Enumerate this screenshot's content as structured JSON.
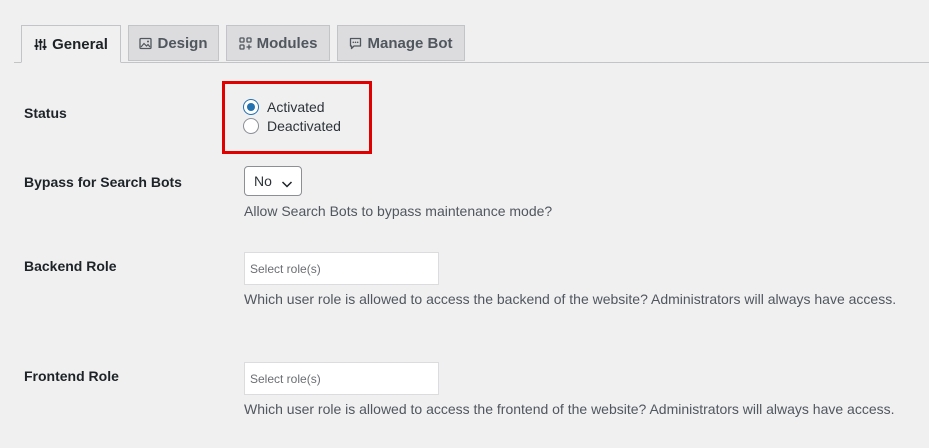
{
  "tabs": [
    {
      "label": "General",
      "icon": "sliders-icon",
      "active": true
    },
    {
      "label": "Design",
      "icon": "image-icon",
      "active": false
    },
    {
      "label": "Modules",
      "icon": "modules-icon",
      "active": false
    },
    {
      "label": "Manage Bot",
      "icon": "chat-bubble-icon",
      "active": false
    }
  ],
  "status": {
    "label": "Status",
    "options": [
      "Activated",
      "Deactivated"
    ],
    "selected": "Activated"
  },
  "bypass": {
    "label": "Bypass for Search Bots",
    "value": "No",
    "description": "Allow Search Bots to bypass maintenance mode?"
  },
  "backend_role": {
    "label": "Backend Role",
    "placeholder": "Select role(s)",
    "description": "Which user role is allowed to access the backend of the website? Administrators will always have access."
  },
  "frontend_role": {
    "label": "Frontend Role",
    "placeholder": "Select role(s)",
    "description": "Which user role is allowed to access the frontend of the website? Administrators will always have access."
  },
  "colors": {
    "highlight": "#e00000",
    "accent": "#2271b1"
  }
}
